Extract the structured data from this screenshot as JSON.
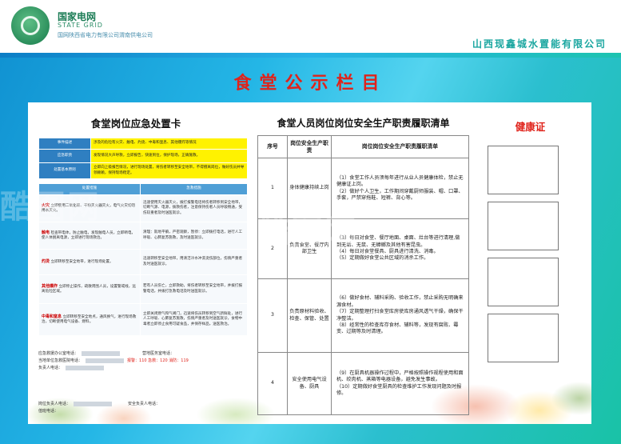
{
  "header": {
    "brand_cn": "国家电网",
    "brand_en": "STATE GRID",
    "brand_full": "国网陕西省电力有限公司渭南供电公司",
    "company": "山西现鑫城水置能有限公司"
  },
  "board_title": "食堂公示栏目",
  "left_card": {
    "title": "食堂岗位应急处置卡",
    "rows": [
      {
        "label": "事件描述",
        "text": "涉及的危险有火灾、触电、灼烫、中毒和窒息、其他爆炸等情况"
      },
      {
        "label": "应急职责",
        "text": "发现情况大声呼救，立即报告，快速到位，保护现场，正确施救。"
      },
      {
        "label": "处置基本原则",
        "text": "立即向上级报告情况，进行现场处置，将伤者转移至安全地带，不得擅离岗位，做好伤员并导领赖赖，保持现场稳定。"
      }
    ],
    "col_head_left": "处置措施",
    "col_head_right": "急救措施",
    "measures": [
      {
        "type": "火灾",
        "action": "立即使用二氧化碳、干粉灭火器灭火，电气火灾切勿用水灭火。",
        "aid": "迅速使用灭火器灭火，拨打报警电话将伤者转移到安全地带，切断气源、电源，拨救伤者，注意保持伤者人员呼吸畅通，受伤较重者及时送医就诊。"
      },
      {
        "type": "触电",
        "action": "检查带电体，防止触电，发现触电人员，立即断电，使人体脱离电源，立即进行现场救治。",
        "aid": "清理：就地平躺，严密观察，暂停：立即拨打电话，进行人工呼吸、心肺复苏施救，及时送医就诊。"
      },
      {
        "type": "灼烫",
        "action": "立即转移至安全地带，进行现场处置。",
        "aid": "迅速转移至安全地带，用清洁冷水冲洗烫伤部位，伤情严重者及时送医就诊。"
      },
      {
        "type": "其他爆炸",
        "action": "立即停止操作，疏散周围人员，设置警戒线，远离危险区域。",
        "aid": "若有人员伤亡，立即救助，将伤者转移至安全地带，并拨打报警电话，并拨打急救电话及时送医就诊。"
      },
      {
        "type": "中毒和窒息",
        "action": "立即转移至安全地点，通风换气，进行现场救治，切断使用电气设备、燃料。",
        "aid": "立即关闭燃气和气阀门，迅速将伤员转移到空气新鲜处，进行人工呼吸、心肺复苏施救，伤情严重者及时送医就诊，食物中毒者立即停止食用可疑食品，并保存样品，送医救治。"
      }
    ],
    "phones": {
      "office_label": "应急救援办公室电话：",
      "office_tel_label": "营地医务室电话：",
      "line2_label": "当地单位急救医院电话：",
      "emergency": "报警：110  急救：120  消防：119",
      "manager_label": "负责人电话：",
      "post_label": "岗位负责人电话：",
      "chief_label": "安全负责人电话：",
      "duty_label": "值班电话："
    }
  },
  "duty_list": {
    "title": "食堂人员岗位岗位安全生产职责履职清单",
    "headers": [
      "序号",
      "岗位安全生产职责",
      "岗位岗位安全生产职责履职清单"
    ],
    "rows": [
      {
        "no": "1",
        "post": "身体健康持续上岗",
        "items": [
          "（1）食堂工作人员须每年进行从业人员健康体检，禁止无健康证上岗。",
          "（2）做好个人卫生，工作期间穿戴厨师服装、帽、口罩、手套，严禁穿拖鞋、短裤、背心等。"
        ]
      },
      {
        "no": "2",
        "post": "负责食堂、餐厅内部卫生",
        "items": [
          "（3）每日对食堂、餐厅地面、桌面、灶台等进行清理,做到无垢、无鼠、无蟑螂及其他有害昆虫。",
          "（4）每日对食堂餐具、厨具进行清洗、消毒。",
          "（5）定期做好食堂公共区域的消杀工作。"
        ]
      },
      {
        "no": "3",
        "post": "负责原材料验收、检查、保管、处置",
        "items": [
          "（6）做好食材、辅料采购、验收工作，禁止采购无明确来源食材。",
          "（7）定期整理打扫食堂库房使库房通风透气干燥，确保干净整洁。",
          "（8）经常性的检查库存食材、辅料等，发现有腐败、霉变、过期等及时清理。"
        ]
      },
      {
        "no": "4",
        "post": "安全使用电气设备、厨具",
        "items": [
          "（9）在厨具机器操作过程中，严格按照操作规程使用和面机、绞肉机、蒸箱等电器设备，避免发生事故。",
          "（10）定期做好食堂厨具的检查维护工作发现问题及时报修。"
        ]
      }
    ]
  },
  "health": {
    "title": "健康证"
  },
  "watermark": [
    "酷图网",
    "酷图网"
  ]
}
